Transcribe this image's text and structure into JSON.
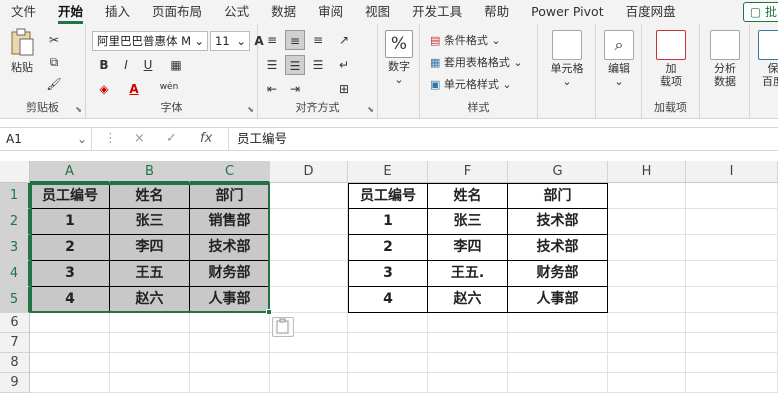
{
  "tabs": [
    "文件",
    "开始",
    "插入",
    "页面布局",
    "公式",
    "数据",
    "审阅",
    "视图",
    "开发工具",
    "帮助",
    "Power Pivot",
    "百度网盘"
  ],
  "share_label": "批",
  "ribbon": {
    "clipboard": {
      "paste": "粘贴",
      "label": "剪贴板"
    },
    "font": {
      "name": "阿里巴巴普惠体 M",
      "size": "11",
      "label": "字体",
      "bold": "B",
      "italic": "I",
      "underline": "U",
      "grow": "A",
      "shrink": "A",
      "wen": "wén"
    },
    "align": {
      "label": "对齐方式"
    },
    "number": {
      "btn": "数字",
      "symbol": "%"
    },
    "styles": {
      "cond": "条件格式",
      "table": "套用表格格式",
      "cell": "单元格样式",
      "label": "样式"
    },
    "cells": {
      "btn": "单元格"
    },
    "editing": {
      "btn": "编辑"
    },
    "addins": {
      "btn_line1": "加",
      "btn_line2": "载项",
      "label": "加载项"
    },
    "analyze": {
      "line1": "分析",
      "line2": "数据"
    },
    "save": {
      "line1": "保",
      "line2": "百度"
    }
  },
  "formula_bar": {
    "name_box": "A1",
    "cancel": "×",
    "enter": "✓",
    "fx": "fx",
    "content": "员工编号"
  },
  "columns": [
    "A",
    "B",
    "C",
    "D",
    "E",
    "F",
    "G",
    "H",
    "I"
  ],
  "rows": [
    "1",
    "2",
    "3",
    "4",
    "5",
    "6",
    "7",
    "8",
    "9"
  ],
  "table_left": {
    "headers": [
      "员工编号",
      "姓名",
      "部门"
    ],
    "rows": [
      [
        "1",
        "张三",
        "销售部"
      ],
      [
        "2",
        "李四",
        "技术部"
      ],
      [
        "3",
        "王五",
        "财务部"
      ],
      [
        "4",
        "赵六",
        "人事部"
      ]
    ]
  },
  "table_right": {
    "headers": [
      "员工编号",
      "姓名",
      "部门"
    ],
    "rows": [
      [
        "1",
        "张三",
        "技术部"
      ],
      [
        "2",
        "李四",
        "技术部"
      ],
      [
        "3",
        "王五.",
        "财务部"
      ],
      [
        "4",
        "赵六",
        "人事部"
      ]
    ]
  }
}
